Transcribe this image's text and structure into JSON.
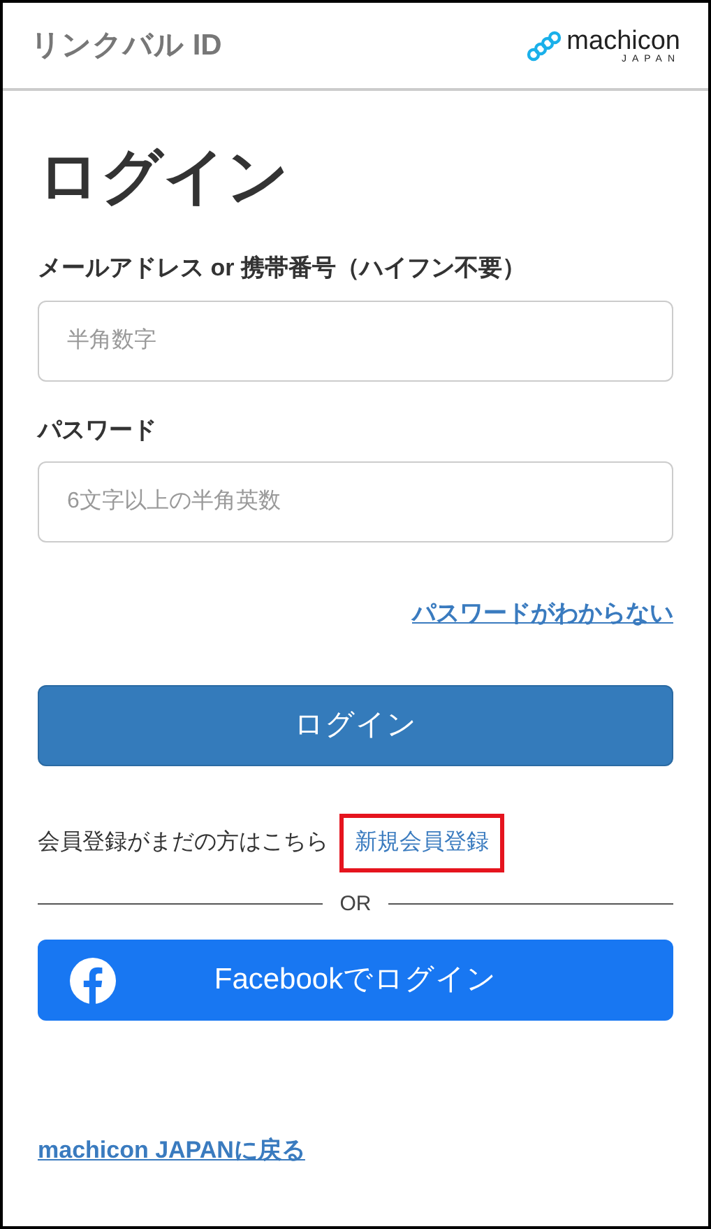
{
  "header": {
    "title": "リンクバル ID",
    "logo": {
      "name": "machicon",
      "sub": "JAPAN"
    }
  },
  "heading": "ログイン",
  "fields": [
    {
      "label": "メールアドレス or 携帯番号（ハイフン不要）",
      "placeholder": "半角数字"
    },
    {
      "label": "パスワード",
      "placeholder": "6文字以上の半角英数"
    }
  ],
  "forgot_link": "パスワードがわからない",
  "login_button": "ログイン",
  "register": {
    "text": "会員登録がまだの方はこちら",
    "link": "新規会員登録",
    "highlighted": true
  },
  "divider": "OR",
  "facebook_button": "Facebookでログイン",
  "back_link": "machicon JAPANに戻る"
}
